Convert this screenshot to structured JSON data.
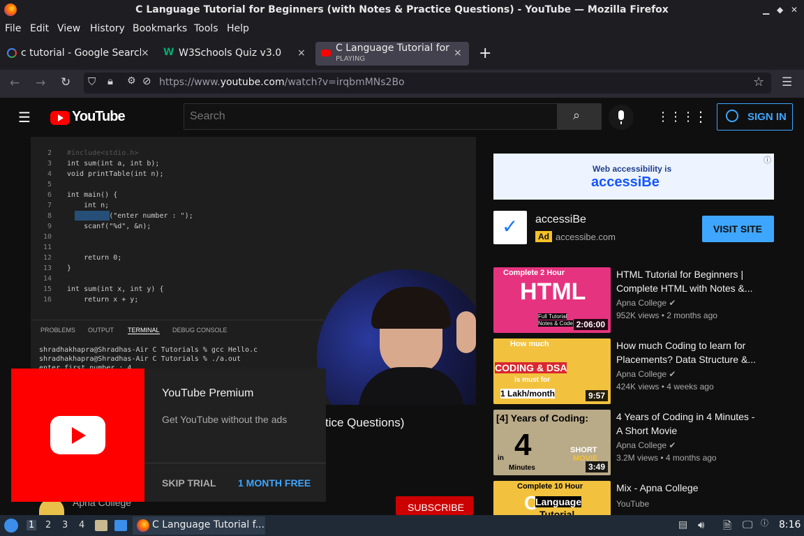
{
  "window": {
    "title": "C Language Tutorial for Beginners (with Notes & Practice Questions) - YouTube — Mozilla Firefox"
  },
  "menu": [
    "File",
    "Edit",
    "View",
    "History",
    "Bookmarks",
    "Tools",
    "Help"
  ],
  "tabs": [
    {
      "label": "c tutorial - Google Search",
      "close": "×"
    },
    {
      "label": "W3Schools Quiz v3.0",
      "close": "×"
    },
    {
      "label": "C Language Tutorial for B",
      "sublabel": "PLAYING",
      "close": "×"
    }
  ],
  "new_tab": "+",
  "url": {
    "prefix": "https://www.",
    "host": "youtube.com",
    "path": "/watch?v=irqbmMNs2Bo"
  },
  "youtube": {
    "logo_text": "YouTube",
    "search_placeholder": "Search",
    "signin_label": "SIGN IN"
  },
  "video": {
    "code_lines": [
      {
        "n": "2",
        "t": "#include<stdio.h>"
      },
      {
        "n": "3",
        "t": "int sum(int a, int b);"
      },
      {
        "n": "4",
        "t": "void printTable(int n);"
      },
      {
        "n": "5",
        "t": ""
      },
      {
        "n": "6",
        "t": "int main() {"
      },
      {
        "n": "7",
        "t": "    int n;"
      },
      {
        "n": "8",
        "t": "    printf(\"enter number : \");"
      },
      {
        "n": "9",
        "t": "    scanf(\"%d\", &n);"
      },
      {
        "n": "10",
        "t": ""
      },
      {
        "n": "11",
        "t": ""
      },
      {
        "n": "12",
        "t": "    return 0;"
      },
      {
        "n": "13",
        "t": "}"
      },
      {
        "n": "14",
        "t": ""
      },
      {
        "n": "15",
        "t": "int sum(int x, int y) {"
      },
      {
        "n": "16",
        "t": "    return x + y;"
      }
    ],
    "terminal_tabs": [
      "PROBLEMS",
      "OUTPUT",
      "TERMINAL",
      "DEBUG CONSOLE"
    ],
    "terminal_lines": [
      "shradhakhapra@Shradhas-Air C Tutorials % gcc Hello.c",
      "shradhakhapra@Shradhas-Air C Tutorials % ./a.out",
      "enter first number : 4"
    ]
  },
  "behind": {
    "title_fragment": "tice Questions)",
    "channel": "Apna College",
    "subscribe": "SUBSCRIBE"
  },
  "premium": {
    "title": "YouTube Premium",
    "subtitle": "Get YouTube without the ads",
    "skip": "SKIP TRIAL",
    "trial": "1 MONTH FREE"
  },
  "ad": {
    "banner_line1": "Web accessibility is",
    "banner_line2": "accessiBe",
    "name": "accessiBe",
    "badge": "Ad",
    "domain": "accessibe.com",
    "cta": "VISIT SITE"
  },
  "recommendations": [
    {
      "title": "HTML Tutorial for Beginners | Complete HTML with Notes &...",
      "channel": "Apna College",
      "meta": "952K views • 2 months ago",
      "duration": "2:06:00",
      "thumb_text": [
        "Complete 2 Hour",
        "HTML",
        "Full Tutorial",
        "Notes & Code"
      ]
    },
    {
      "title": "How much Coding to learn for Placements? Data Structure &...",
      "channel": "Apna College",
      "meta": "424K views • 4 weeks ago",
      "duration": "9:57",
      "thumb_text": [
        "How much",
        "CODING & DSA",
        "is must for",
        "1 Lakh/month"
      ]
    },
    {
      "title": "4 Years of Coding in 4 Minutes - A Short Movie",
      "channel": "Apna College",
      "meta": "3.2M views • 4 months ago",
      "duration": "3:49",
      "thumb_text": [
        "[4] Years of Coding:",
        "4",
        "in",
        "Minutes",
        "SHORT",
        "MOVIE"
      ]
    },
    {
      "title": "Mix - Apna College",
      "channel": "YouTube",
      "meta": "",
      "duration": "",
      "thumb_text": [
        "Complete 10 Hour",
        "C",
        "Language",
        "Tutorial"
      ]
    }
  ],
  "taskbar": {
    "workspaces": [
      "1",
      "2",
      "3",
      "4"
    ],
    "active_window": "C Language Tutorial f...",
    "clock": "8:16"
  }
}
